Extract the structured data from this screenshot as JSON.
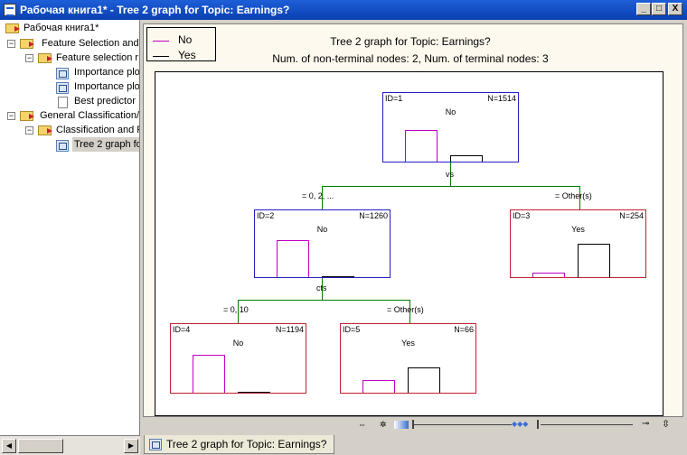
{
  "window": {
    "title": "Рабочая книга1* - Tree 2 graph for Topic: Earnings?",
    "minimize": "_",
    "maximize": "□",
    "close": "X"
  },
  "tree": {
    "items": [
      {
        "label": "Рабочая книга1*"
      },
      {
        "label": "Feature Selection and"
      },
      {
        "label": "Feature selection r"
      },
      {
        "label": "Importance plo"
      },
      {
        "label": "Importance plo"
      },
      {
        "label": "Best predictor"
      },
      {
        "label": "General Classification/R"
      },
      {
        "label": "Classification and R"
      },
      {
        "label": "Tree 2 graph fo"
      }
    ]
  },
  "graph": {
    "legend": [
      {
        "label": "No",
        "color": "#c000c0"
      },
      {
        "label": "Yes",
        "color": "#000000"
      }
    ],
    "title": "Tree 2 graph for Topic: Earnings?",
    "subtitle": "Num. of non-terminal nodes: 2,  Num. of terminal nodes: 3",
    "nodes": [
      {
        "id": "ID=1",
        "n": "N=1514",
        "cls": "No",
        "no_frac": 0.83,
        "yes_frac": 0.17
      },
      {
        "id": "ID=2",
        "n": "N=1260",
        "cls": "No",
        "no_frac": 0.97,
        "yes_frac": 0.03
      },
      {
        "id": "ID=3",
        "n": "N=254",
        "cls": "Yes",
        "no_frac": 0.12,
        "yes_frac": 0.88
      },
      {
        "id": "ID=4",
        "n": "N=1194",
        "cls": "No",
        "no_frac": 0.99,
        "yes_frac": 0.01
      },
      {
        "id": "ID=5",
        "n": "N=66",
        "cls": "Yes",
        "no_frac": 0.33,
        "yes_frac": 0.67
      }
    ],
    "splits": [
      {
        "var": "vs",
        "left": "= 0, 2, ...",
        "right": "= Other(s)"
      },
      {
        "var": "cts",
        "left": "= 0, 10",
        "right": "= Other(s)"
      }
    ],
    "colors": {
      "non_terminal_border": "#2020c0",
      "terminal_border": "#c02030",
      "connector": "#008000"
    }
  },
  "tabs": [
    {
      "label": "Tree 2 graph for Topic: Earnings?"
    }
  ]
}
